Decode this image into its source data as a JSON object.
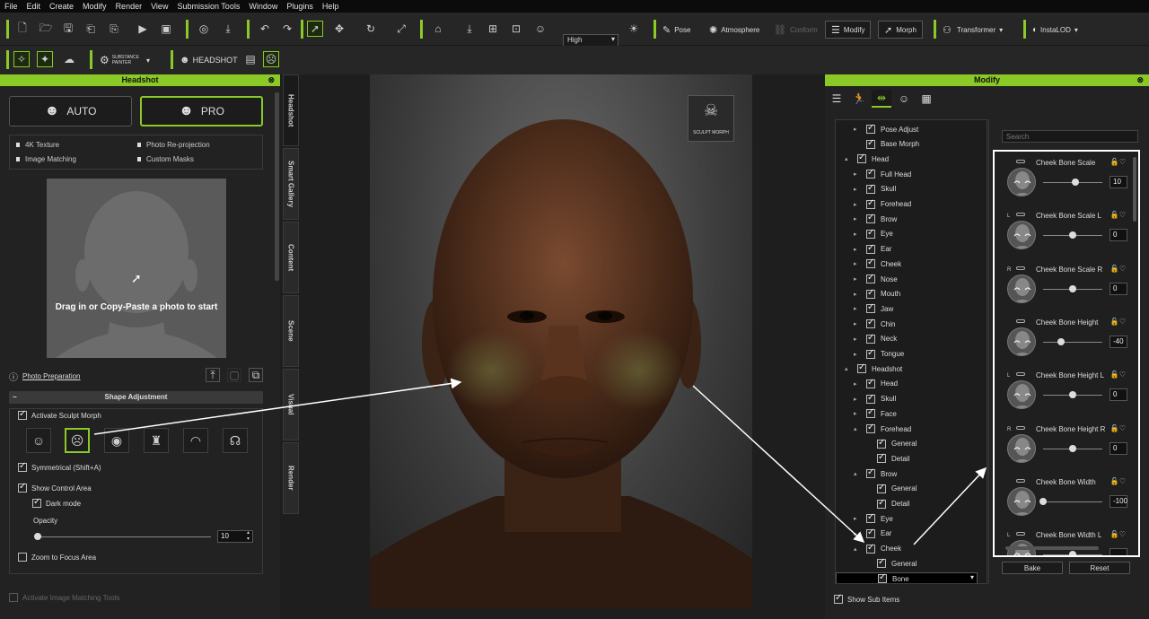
{
  "menubar": {
    "items": [
      "File",
      "Edit",
      "Create",
      "Modify",
      "Render",
      "View",
      "Submission Tools",
      "Window",
      "Plugins",
      "Help"
    ]
  },
  "toolbar": {
    "quality_value": "High",
    "pose_label": "Pose",
    "atmosphere_label": "Atmosphere",
    "conform_label": "Conform",
    "modify_label": "Modify",
    "morph_label": "Morph",
    "transformer_label": "Transformer",
    "instalod_label": "InstaLOD",
    "substance_label_1": "SUBSTANCE",
    "substance_label_2": "PAINTER",
    "headshot_label": "HEADSHOT"
  },
  "headshot_panel": {
    "title": "Headshot",
    "auto_label": "AUTO",
    "pro_label": "PRO",
    "features": [
      "4K Texture",
      "Photo Re-projection",
      "Image Matching",
      "Custom Masks"
    ],
    "photo_hint": "Drag in or Copy-Paste a photo to start",
    "photo_prep_link": "Photo Preparation",
    "shape_adjustment_title": "Shape Adjustment",
    "activate_sculpt_morph": "Activate Sculpt Morph",
    "symmetrical": "Symmetrical (Shift+A)",
    "show_control_area": "Show Control Area",
    "dark_mode": "Dark mode",
    "opacity_label": "Opacity",
    "opacity_value": "10",
    "opacity_fraction": 0.0,
    "zoom_to_focus": "Zoom to Focus Area",
    "activate_image_matching": "Activate Image Matching Tools"
  },
  "side_tabs": [
    "Headshot",
    "Smart Gallery",
    "Content",
    "Scene",
    "Visual",
    "Render"
  ],
  "viewport": {
    "sculpt_logo_label": "SCULPT MORPH"
  },
  "modify_panel": {
    "title": "Modify",
    "search_placeholder": "Search",
    "tree": [
      {
        "label": "Pose Adjust",
        "depth": 1,
        "arrow": "▸",
        "checked": true
      },
      {
        "label": "Base Morph",
        "depth": 1,
        "arrow": "",
        "checked": true
      },
      {
        "label": "Head",
        "depth": 0,
        "arrow": "▴",
        "checked": true
      },
      {
        "label": "Full Head",
        "depth": 1,
        "arrow": "▸",
        "checked": true
      },
      {
        "label": "Skull",
        "depth": 1,
        "arrow": "▸",
        "checked": true
      },
      {
        "label": "Forehead",
        "depth": 1,
        "arrow": "▸",
        "checked": true
      },
      {
        "label": "Brow",
        "depth": 1,
        "arrow": "▸",
        "checked": true
      },
      {
        "label": "Eye",
        "depth": 1,
        "arrow": "▸",
        "checked": true
      },
      {
        "label": "Ear",
        "depth": 1,
        "arrow": "▸",
        "checked": true
      },
      {
        "label": "Cheek",
        "depth": 1,
        "arrow": "▸",
        "checked": true
      },
      {
        "label": "Nose",
        "depth": 1,
        "arrow": "▸",
        "checked": true
      },
      {
        "label": "Mouth",
        "depth": 1,
        "arrow": "▸",
        "checked": true
      },
      {
        "label": "Jaw",
        "depth": 1,
        "arrow": "▸",
        "checked": true
      },
      {
        "label": "Chin",
        "depth": 1,
        "arrow": "▸",
        "checked": true
      },
      {
        "label": "Neck",
        "depth": 1,
        "arrow": "▸",
        "checked": true
      },
      {
        "label": "Tongue",
        "depth": 1,
        "arrow": "▸",
        "checked": true
      },
      {
        "label": "Headshot",
        "depth": 0,
        "arrow": "▴",
        "checked": true
      },
      {
        "label": "Head",
        "depth": 1,
        "arrow": "▸",
        "checked": true
      },
      {
        "label": "Skull",
        "depth": 1,
        "arrow": "▸",
        "checked": true
      },
      {
        "label": "Face",
        "depth": 1,
        "arrow": "▸",
        "checked": true
      },
      {
        "label": "Forehead",
        "depth": 1,
        "arrow": "▴",
        "checked": true
      },
      {
        "label": "General",
        "depth": 2,
        "arrow": "",
        "checked": true
      },
      {
        "label": "Detail",
        "depth": 2,
        "arrow": "",
        "checked": true
      },
      {
        "label": "Brow",
        "depth": 1,
        "arrow": "▴",
        "checked": true
      },
      {
        "label": "General",
        "depth": 2,
        "arrow": "",
        "checked": true
      },
      {
        "label": "Detail",
        "depth": 2,
        "arrow": "",
        "checked": true
      },
      {
        "label": "Eye",
        "depth": 1,
        "arrow": "▸",
        "checked": true
      },
      {
        "label": "Ear",
        "depth": 1,
        "arrow": "▸",
        "checked": true
      },
      {
        "label": "Cheek",
        "depth": 1,
        "arrow": "▴",
        "checked": true
      },
      {
        "label": "General",
        "depth": 2,
        "arrow": "",
        "checked": true
      },
      {
        "label": "Bone",
        "depth": 2,
        "arrow": "",
        "checked": true,
        "selected": true
      }
    ],
    "sliders": [
      {
        "title": "Cheek Bone Scale",
        "side": "",
        "value": "10",
        "fraction": 0.55
      },
      {
        "title": "Cheek Bone Scale L",
        "side": "L",
        "value": "0",
        "fraction": 0.5
      },
      {
        "title": "Cheek Bone Scale R",
        "side": "R",
        "value": "0",
        "fraction": 0.5
      },
      {
        "title": "Cheek Bone Height",
        "side": "",
        "value": "-40",
        "fraction": 0.3
      },
      {
        "title": "Cheek Bone Height L",
        "side": "L",
        "value": "0",
        "fraction": 0.5
      },
      {
        "title": "Cheek Bone Height R",
        "side": "R",
        "value": "0",
        "fraction": 0.5
      },
      {
        "title": "Cheek Bone Width",
        "side": "",
        "value": "-100",
        "fraction": 0.0
      },
      {
        "title": "Cheek Bone Width L",
        "side": "L",
        "value": "",
        "fraction": 0.5
      }
    ],
    "bake_label": "Bake",
    "reset_label": "Reset",
    "show_sub_items": "Show Sub Items"
  },
  "colors": {
    "accent": "#8ac926"
  }
}
